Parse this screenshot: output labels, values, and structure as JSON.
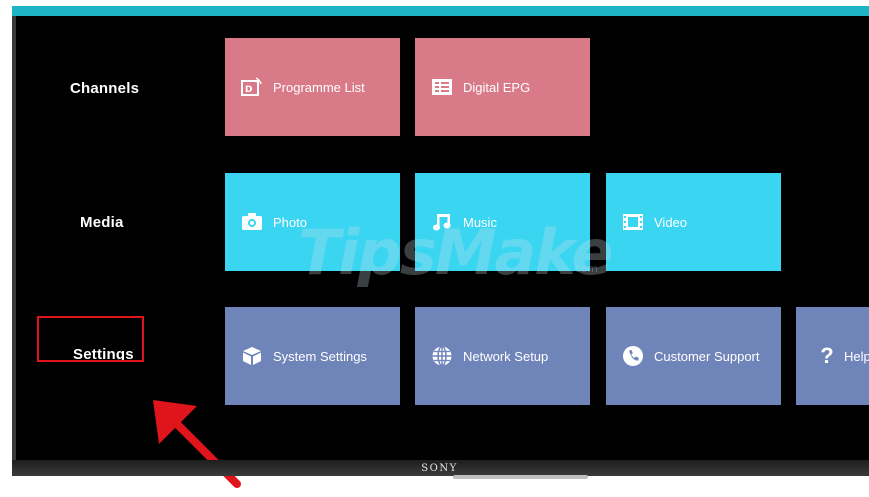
{
  "brand": "SONY",
  "watermark": "TipsMake",
  "watermark_suffix": ".com",
  "rows": {
    "channels": "Channels",
    "media": "Media",
    "settings": "Settings"
  },
  "tiles": {
    "programme_list": "Programme List",
    "digital_epg": "Digital EPG",
    "photo": "Photo",
    "music": "Music",
    "video": "Video",
    "system_settings": "System Settings",
    "network_setup": "Network Setup",
    "customer_support": "Customer Support",
    "help": "Help"
  },
  "colors": {
    "channels_tile": "#d97a88",
    "media_tile": "#39d5f1",
    "settings_tile": "#6f84b8",
    "highlight": "#e0141b",
    "arrow": "#e0141b"
  },
  "icons": {
    "programme_list": "programme-list-icon",
    "digital_epg": "epg-icon",
    "photo": "camera-icon",
    "music": "music-note-icon",
    "video": "film-icon",
    "system_settings": "cube-icon",
    "network_setup": "globe-icon",
    "customer_support": "phone-icon",
    "help": "question-icon"
  }
}
